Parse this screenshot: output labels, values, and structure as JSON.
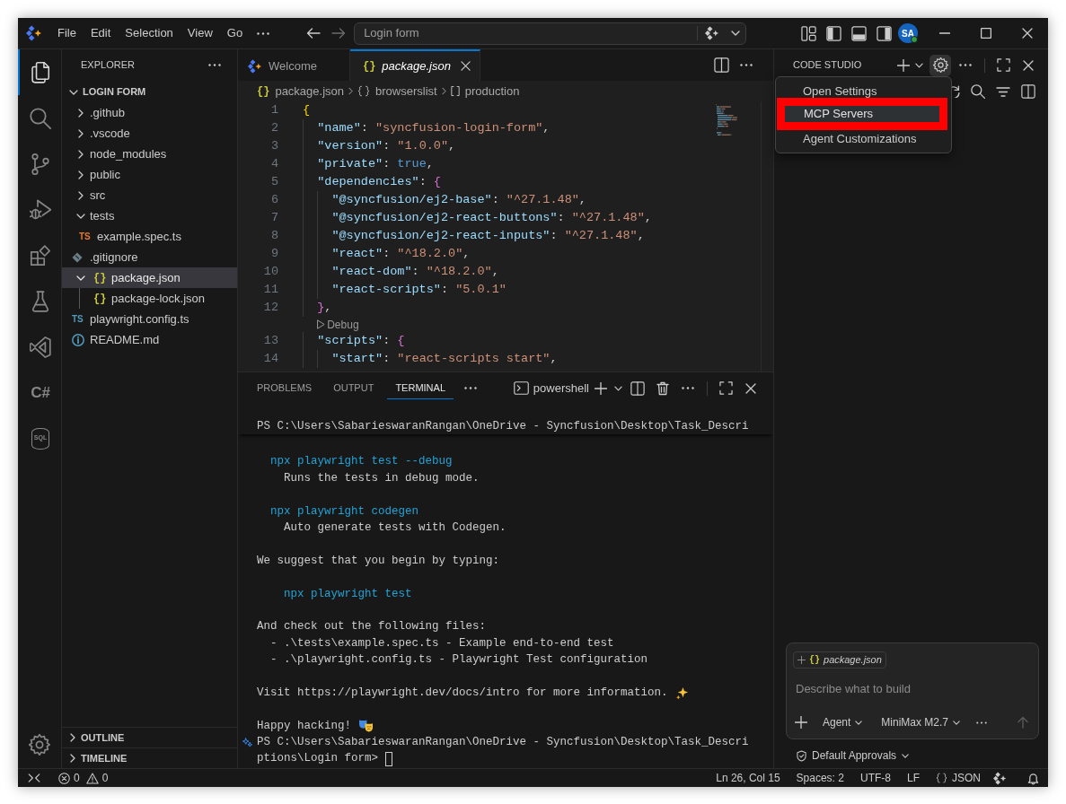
{
  "title_bar": {
    "menus": [
      "File",
      "Edit",
      "Selection",
      "View",
      "Go"
    ],
    "command_center": "Login form",
    "account": "SA"
  },
  "activity_bar": {
    "items": [
      {
        "kind": "files",
        "selected": true
      },
      {
        "kind": "search",
        "selected": false
      },
      {
        "kind": "source-control",
        "selected": false
      },
      {
        "kind": "run-debug",
        "selected": false
      },
      {
        "kind": "extensions",
        "selected": false
      },
      {
        "kind": "testing",
        "selected": false
      },
      {
        "kind": "visual-studio",
        "selected": false
      },
      {
        "kind": "csharp",
        "label": "C#",
        "selected": false
      },
      {
        "kind": "database",
        "label": "SQL",
        "selected": false
      }
    ]
  },
  "explorer": {
    "title": "EXPLORER",
    "tree": [
      {
        "label": "LOGIN FORM",
        "kind": "root",
        "expanded": true,
        "selected": false,
        "children": [
          {
            "label": ".github",
            "kind": "folder",
            "expanded": false,
            "selected": false
          },
          {
            "label": ".vscode",
            "kind": "folder",
            "expanded": false,
            "selected": false
          },
          {
            "label": "node_modules",
            "kind": "folder",
            "expanded": false,
            "selected": false
          },
          {
            "label": "public",
            "kind": "folder",
            "expanded": false,
            "selected": false
          },
          {
            "label": "src",
            "kind": "folder",
            "expanded": false,
            "selected": false
          },
          {
            "label": "tests",
            "kind": "folder",
            "expanded": true,
            "selected": false,
            "children": [
              {
                "label": "example.spec.ts",
                "kind": "ts",
                "icon_text": "TS",
                "color": "#e37933",
                "selected": false
              }
            ]
          },
          {
            "label": ".gitignore",
            "kind": "git",
            "selected": false
          },
          {
            "label": "package.json",
            "kind": "json",
            "icon_text": "{}",
            "color": "#cbcb41",
            "expanded": true,
            "selected": true,
            "children": [
              {
                "label": "package-lock.json",
                "kind": "json",
                "icon_text": "{}",
                "color": "#cbcb41",
                "selected": false
              }
            ]
          },
          {
            "label": "playwright.config.ts",
            "kind": "ts",
            "icon_text": "TS",
            "color": "#519aba",
            "selected": false
          },
          {
            "label": "README.md",
            "kind": "info",
            "selected": false
          }
        ]
      }
    ],
    "sections": [
      {
        "label": "OUTLINE",
        "expanded": false
      },
      {
        "label": "TIMELINE",
        "expanded": false
      }
    ]
  },
  "editor": {
    "tabs": [
      {
        "label": "Welcome",
        "kind": "welcome",
        "selected": false,
        "preview": false
      },
      {
        "label": "package.json",
        "kind": "json",
        "icon_text": "{}",
        "selected": true,
        "preview": true
      }
    ],
    "breadcrumb": [
      {
        "label": "package.json",
        "kind": "json",
        "icon_text": "{}"
      },
      {
        "label": "browserslist",
        "kind": "object"
      },
      {
        "label": "production",
        "kind": "array"
      }
    ],
    "lines": [
      {
        "kind": "code",
        "number": "1",
        "tokens": [
          {
            "text": "{",
            "kind": "bracket1"
          }
        ]
      },
      {
        "kind": "code",
        "number": "2",
        "tokens": [
          {
            "text": "  \"name\"",
            "kind": "key"
          },
          {
            "text": ": ",
            "kind": "punct"
          },
          {
            "text": "\"syncfusion-login-form\"",
            "kind": "string"
          },
          {
            "text": ",",
            "kind": "punct"
          }
        ]
      },
      {
        "kind": "code",
        "number": "3",
        "tokens": [
          {
            "text": "  \"version\"",
            "kind": "key"
          },
          {
            "text": ": ",
            "kind": "punct"
          },
          {
            "text": "\"1.0.0\"",
            "kind": "string"
          },
          {
            "text": ",",
            "kind": "punct"
          }
        ]
      },
      {
        "kind": "code",
        "number": "4",
        "tokens": [
          {
            "text": "  \"private\"",
            "kind": "key"
          },
          {
            "text": ": ",
            "kind": "punct"
          },
          {
            "text": "true",
            "kind": "literal"
          },
          {
            "text": ",",
            "kind": "punct"
          }
        ]
      },
      {
        "kind": "code",
        "number": "5",
        "tokens": [
          {
            "text": "  \"dependencies\"",
            "kind": "key"
          },
          {
            "text": ": ",
            "kind": "punct"
          },
          {
            "text": "{",
            "kind": "bracket2"
          }
        ]
      },
      {
        "kind": "code",
        "number": "6",
        "tokens": [
          {
            "text": "    \"@syncfusion/ej2-base\"",
            "kind": "key"
          },
          {
            "text": ": ",
            "kind": "punct"
          },
          {
            "text": "\"^27.1.48\"",
            "kind": "string"
          },
          {
            "text": ",",
            "kind": "punct"
          }
        ]
      },
      {
        "kind": "code",
        "number": "7",
        "tokens": [
          {
            "text": "    \"@syncfusion/ej2-react-buttons\"",
            "kind": "key"
          },
          {
            "text": ": ",
            "kind": "punct"
          },
          {
            "text": "\"^27.1.48\"",
            "kind": "string"
          },
          {
            "text": ",",
            "kind": "punct"
          }
        ]
      },
      {
        "kind": "code",
        "number": "8",
        "tokens": [
          {
            "text": "    \"@syncfusion/ej2-react-inputs\"",
            "kind": "key"
          },
          {
            "text": ": ",
            "kind": "punct"
          },
          {
            "text": "\"^27.1.48\"",
            "kind": "string"
          },
          {
            "text": ",",
            "kind": "punct"
          }
        ]
      },
      {
        "kind": "code",
        "number": "9",
        "tokens": [
          {
            "text": "    \"react\"",
            "kind": "key"
          },
          {
            "text": ": ",
            "kind": "punct"
          },
          {
            "text": "\"^18.2.0\"",
            "kind": "string"
          },
          {
            "text": ",",
            "kind": "punct"
          }
        ]
      },
      {
        "kind": "code",
        "number": "10",
        "tokens": [
          {
            "text": "    \"react-dom\"",
            "kind": "key"
          },
          {
            "text": ": ",
            "kind": "punct"
          },
          {
            "text": "\"^18.2.0\"",
            "kind": "string"
          },
          {
            "text": ",",
            "kind": "punct"
          }
        ]
      },
      {
        "kind": "code",
        "number": "11",
        "tokens": [
          {
            "text": "    \"react-scripts\"",
            "kind": "key"
          },
          {
            "text": ": ",
            "kind": "punct"
          },
          {
            "text": "\"5.0.1\"",
            "kind": "string"
          }
        ]
      },
      {
        "kind": "code",
        "number": "12",
        "tokens": [
          {
            "text": "  }",
            "kind": "bracket2"
          },
          {
            "text": ",",
            "kind": "punct"
          }
        ]
      },
      {
        "kind": "codelens",
        "label": "Debug"
      },
      {
        "kind": "code",
        "number": "13",
        "tokens": [
          {
            "text": "  \"scripts\"",
            "kind": "key"
          },
          {
            "text": ": ",
            "kind": "punct"
          },
          {
            "text": "{",
            "kind": "bracket2"
          }
        ]
      },
      {
        "kind": "code",
        "number": "14",
        "tokens": [
          {
            "text": "    \"start\"",
            "kind": "key"
          },
          {
            "text": ": ",
            "kind": "punct"
          },
          {
            "text": "\"react-scripts start\"",
            "kind": "string"
          },
          {
            "text": ",",
            "kind": "punct"
          }
        ]
      }
    ]
  },
  "panel": {
    "tabs": [
      {
        "label": "PROBLEMS",
        "selected": false
      },
      {
        "label": "OUTPUT",
        "selected": false
      },
      {
        "label": "TERMINAL",
        "selected": true
      }
    ],
    "terminal": {
      "shell": "powershell",
      "sticky_line": "PS C:\\Users\\SabarieswaranRangan\\OneDrive - Syncfusion\\Desktop\\Task_Descri",
      "lines": [
        {
          "kind": "command",
          "text": "  npx playwright test --debug"
        },
        {
          "kind": "output",
          "text": "    Runs the tests in debug mode."
        },
        {
          "kind": "blank"
        },
        {
          "kind": "command",
          "text": "  npx playwright codegen"
        },
        {
          "kind": "output",
          "text": "    Auto generate tests with Codegen."
        },
        {
          "kind": "blank"
        },
        {
          "kind": "output",
          "text": "We suggest that you begin by typing:"
        },
        {
          "kind": "blank"
        },
        {
          "kind": "command",
          "text": "    npx playwright test"
        },
        {
          "kind": "blank"
        },
        {
          "kind": "output",
          "text": "And check out the following files:"
        },
        {
          "kind": "output",
          "text": "  - .\\tests\\example.spec.ts - Example end-to-end test"
        },
        {
          "kind": "output",
          "text": "  - .\\playwright.config.ts - Playwright Test configuration"
        },
        {
          "kind": "blank"
        },
        {
          "kind": "output",
          "text": "Visit https://playwright.dev/docs/intro for more information.",
          "emoji": {
            "kind": "sparkles"
          }
        },
        {
          "kind": "blank"
        },
        {
          "kind": "output",
          "text": "Happy hacking!",
          "emoji": {
            "kind": "masks"
          }
        },
        {
          "kind": "prompt",
          "text": "PS C:\\Users\\SabarieswaranRangan\\OneDrive - Syncfusion\\Desktop\\Task_Descri"
        },
        {
          "kind": "input",
          "text": "ptions\\Login form>"
        }
      ]
    }
  },
  "code_studio": {
    "title": "CODE STUDIO",
    "settings_menu": {
      "open": true,
      "items": [
        {
          "label": "Open Settings",
          "selected": false,
          "callout": false
        },
        {
          "label": "MCP Servers",
          "selected": true,
          "callout": true
        },
        {
          "label": "Agent Customizations",
          "selected": false,
          "callout": false
        }
      ]
    },
    "chat": {
      "attachment": {
        "icon_text": "{}",
        "label": "package.json"
      },
      "placeholder": "Describe what to build",
      "mode": "Agent",
      "model": "MiniMax M2.7",
      "send_disabled": true
    },
    "approvals": "Default Approvals"
  },
  "status_bar": {
    "problems": [
      {
        "kind": "error",
        "count": "0"
      },
      {
        "kind": "warning",
        "count": "0"
      }
    ],
    "items": [
      {
        "kind": "text",
        "label": "Ln 26, Col 15"
      },
      {
        "kind": "text",
        "label": "Spaces: 2"
      },
      {
        "kind": "text",
        "label": "UTF-8"
      },
      {
        "kind": "text",
        "label": "LF"
      },
      {
        "kind": "language",
        "label": "JSON"
      }
    ]
  }
}
